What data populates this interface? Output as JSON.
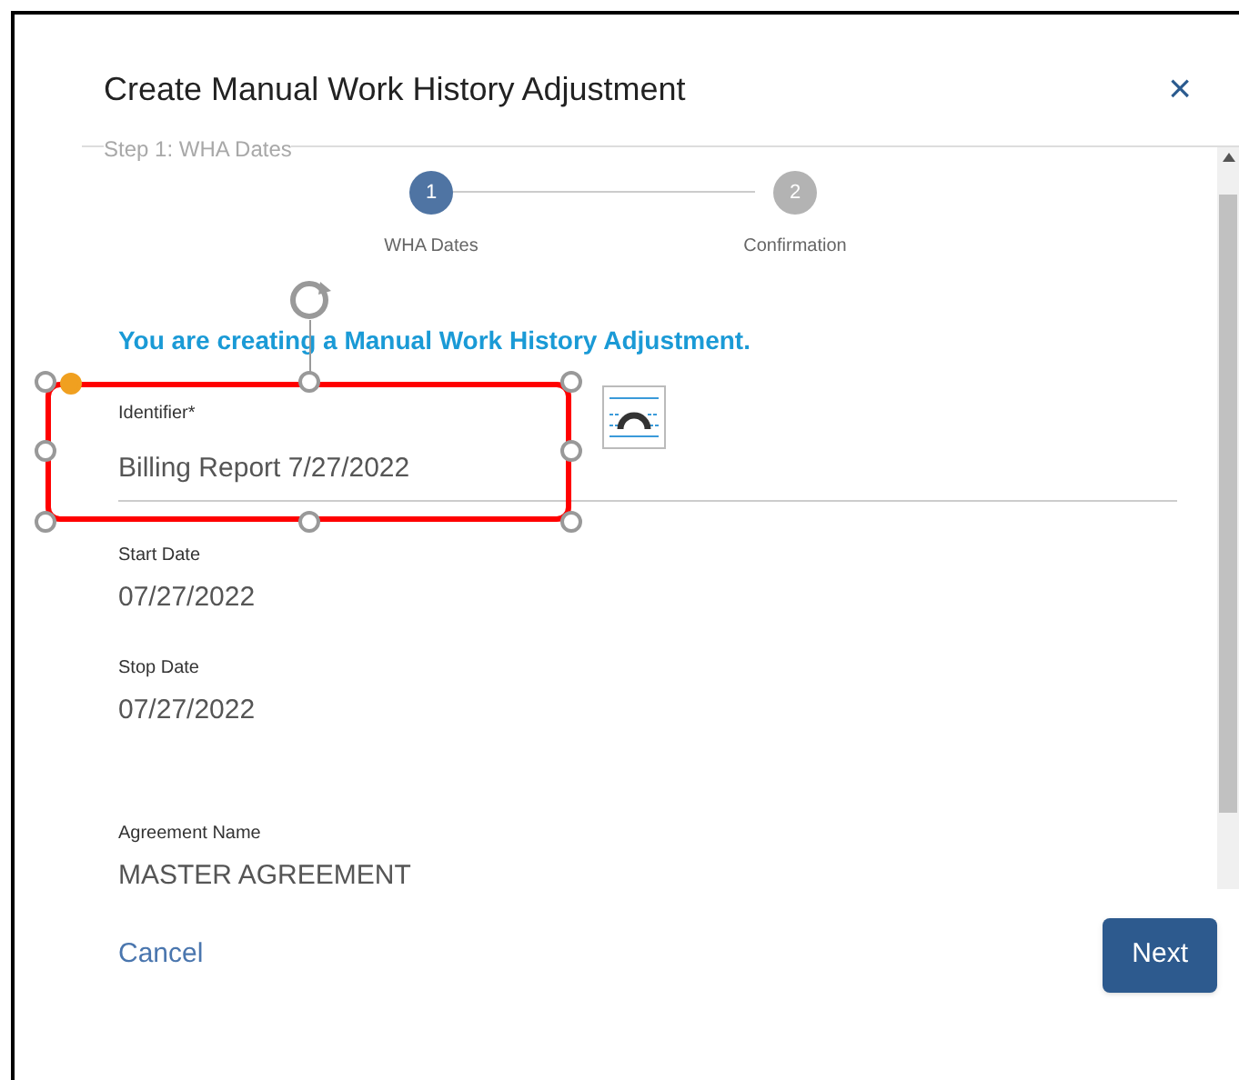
{
  "dialog": {
    "title": "Create Manual Work History Adjustment",
    "close": "×",
    "step_heading": "Step 1: WHA Dates"
  },
  "steps": [
    {
      "number": "1",
      "label": "WHA Dates",
      "selected": true
    },
    {
      "number": "2",
      "label": "Confirmation",
      "selected": false
    }
  ],
  "intro": "You are creating a Manual Work History Adjustment.",
  "identifier": {
    "label": "Identifier*",
    "value": "Billing Report 7/27/2022"
  },
  "fields": [
    {
      "label": "Start Date",
      "value": "07/27/2022"
    },
    {
      "label": "Stop Date",
      "value": "07/27/2022"
    },
    {
      "label": "Agreement Name",
      "value": "MASTER AGREEMENT"
    }
  ],
  "buttons": {
    "cancel": "Cancel",
    "next": "Next"
  }
}
